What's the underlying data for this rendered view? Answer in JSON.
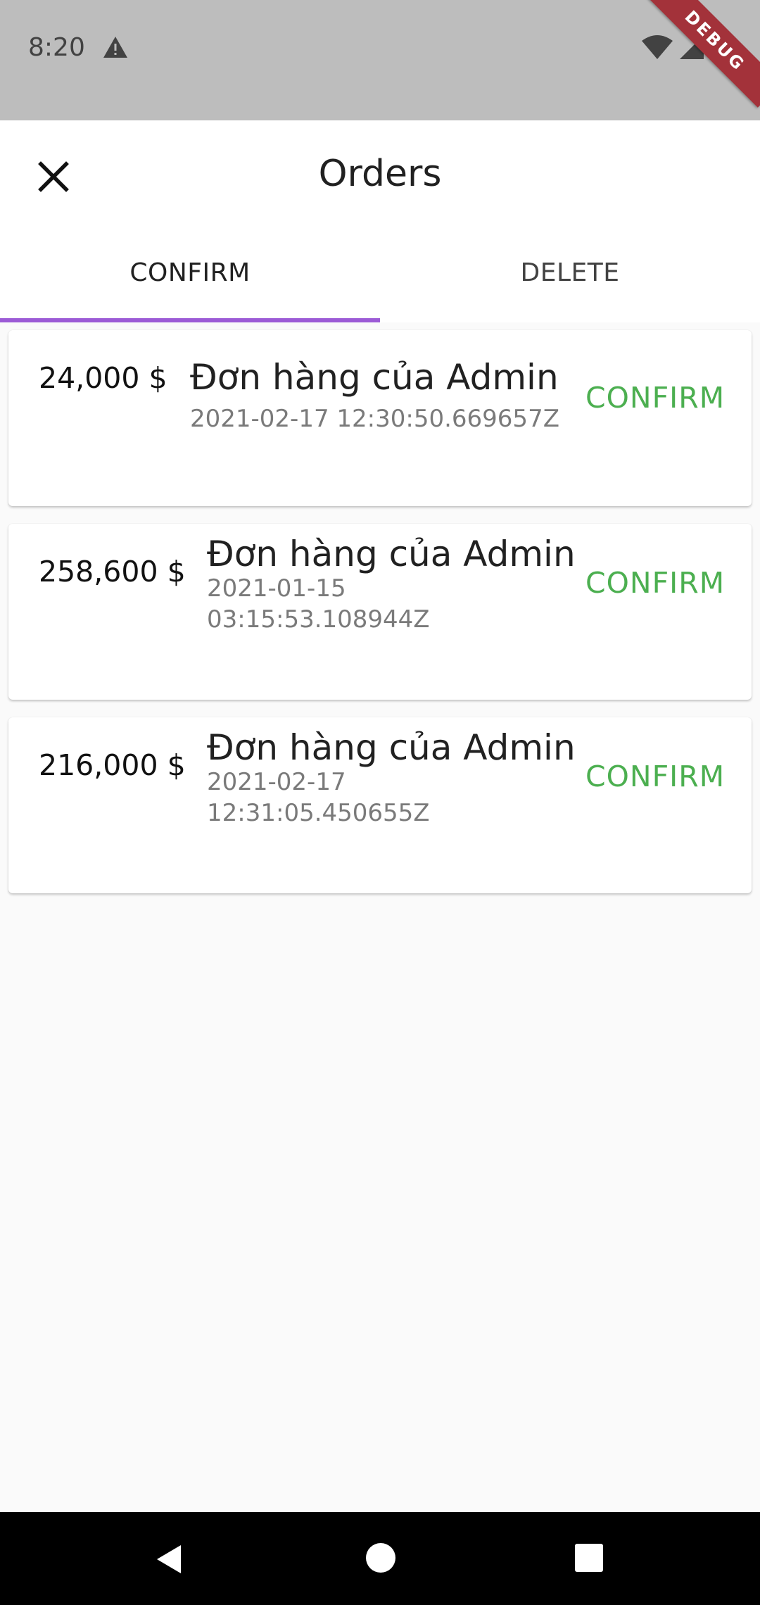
{
  "status_bar": {
    "time": "8:20",
    "debug_label": "DEBUG"
  },
  "app_bar": {
    "title": "Orders"
  },
  "tabs": [
    {
      "label": "CONFIRM",
      "selected": true
    },
    {
      "label": "DELETE",
      "selected": false
    }
  ],
  "orders": [
    {
      "price": "24,000 $",
      "title": "Đơn hàng của Admin",
      "date": "2021-02-17 12:30:50.669657Z",
      "action": "CONFIRM"
    },
    {
      "price": "258,600 $",
      "title": "Đơn hàng của Admin",
      "date": "2021-01-15 03:15:53.108944Z",
      "action": "CONFIRM"
    },
    {
      "price": "216,000 $",
      "title": "Đơn hàng của Admin",
      "date": "2021-02-17 12:31:05.450655Z",
      "action": "CONFIRM"
    }
  ],
  "colors": {
    "accent": "#9c5bd6",
    "confirm": "#4caf50",
    "status_bar": "#bdbdbd",
    "debug_ribbon": "#a3323a"
  },
  "icons": {
    "close": "close-icon",
    "warning": "warning-icon",
    "wifi": "wifi-icon",
    "signal": "signal-icon",
    "battery": "battery-icon",
    "back": "back-icon",
    "home": "home-icon",
    "recents": "recents-icon"
  }
}
